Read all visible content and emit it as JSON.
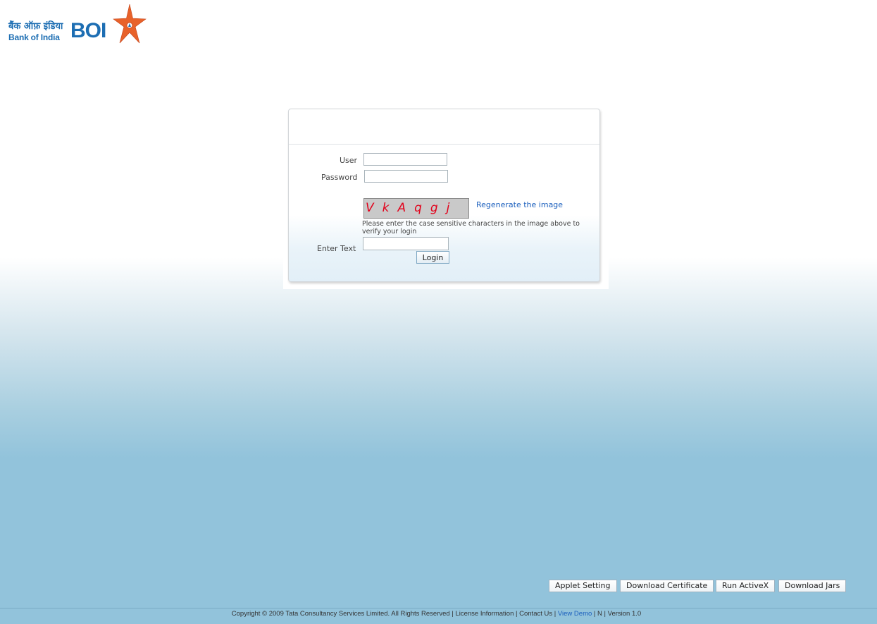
{
  "logo": {
    "hindi_text": "बैंक ऑफ़ इंडिया",
    "english_text": "Bank of India",
    "abbrev": "BOI"
  },
  "login": {
    "user_label": "User",
    "user_value": "",
    "password_label": "Password",
    "password_value": "",
    "captcha_text": "VkAqgj",
    "regenerate_link": "Regenerate the image",
    "captcha_hint": "Please enter the case sensitive characters in the image above to verify your login",
    "enter_text_label": "Enter Text",
    "enter_text_value": "",
    "login_button": "Login"
  },
  "footer_buttons": {
    "applet_setting": "Applet Setting",
    "download_certificate": "Download Certificate",
    "run_activex": "Run ActiveX",
    "download_jars": "Download Jars"
  },
  "footer": {
    "copyright": "Copyright © 2009 Tata Consultancy Services Limited. All Rights Reserved",
    "license": "License Information",
    "contact": "Contact Us",
    "view_demo": "View Demo",
    "n": "N",
    "version": "Version 1.0",
    "separator": "|"
  },
  "colors": {
    "brand_blue": "#1d6eb3",
    "star_orange": "#e8622a",
    "captcha_red": "#e2001a",
    "link_blue": "#1b5fbd",
    "background_blue": "#92c3db"
  }
}
